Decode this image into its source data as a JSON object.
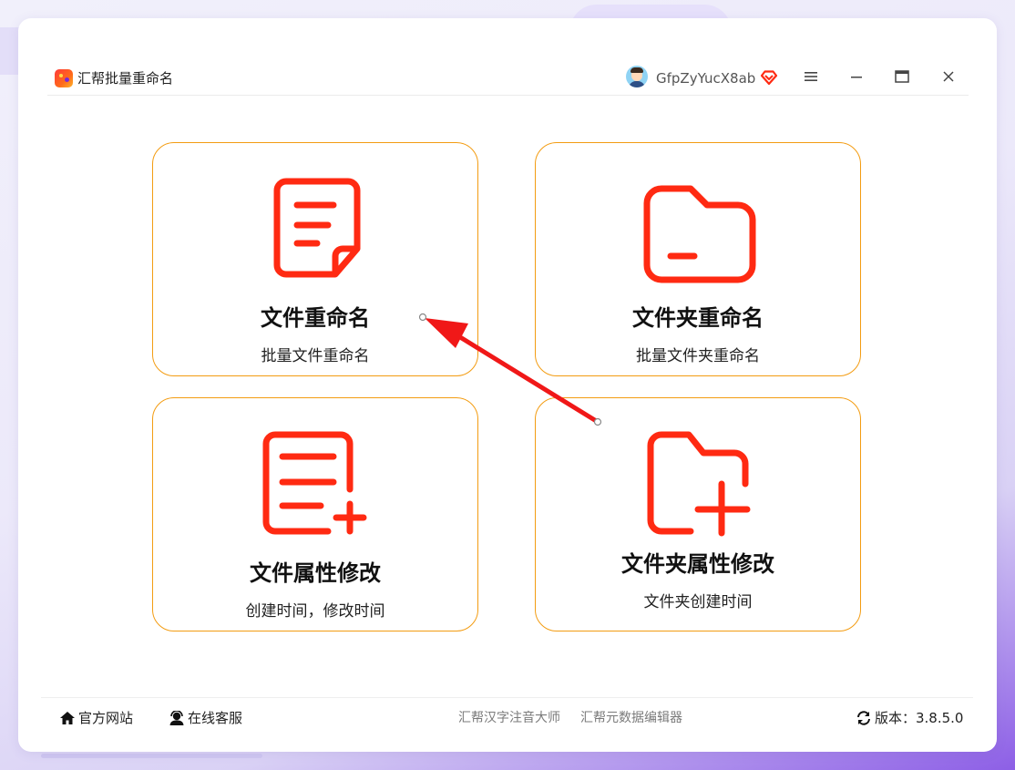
{
  "window": {
    "app_title": "汇帮批量重命名",
    "username": "GfpZyYucX8ab",
    "controls": {
      "menu_icon": "hamburger-icon",
      "minimize_icon": "minimize-icon",
      "maximize_icon": "maximize-icon",
      "close_icon": "close-icon"
    }
  },
  "cards": [
    {
      "title": "文件重命名",
      "subtitle": "批量文件重命名",
      "icon": "document-icon"
    },
    {
      "title": "文件夹重命名",
      "subtitle": "批量文件夹重命名",
      "icon": "folder-icon"
    },
    {
      "title": "文件属性修改",
      "subtitle": "创建时间，修改时间",
      "icon": "document-add-icon"
    },
    {
      "title": "文件夹属性修改",
      "subtitle": "文件夹创建时间",
      "icon": "folder-add-icon"
    }
  ],
  "footer": {
    "official_site": "官方网站",
    "support": "在线客服",
    "link_1": "汇帮汉字注音大师",
    "link_2": "汇帮元数据编辑器",
    "version": "版本：3.8.5.0"
  },
  "colors": {
    "accent_red": "#ff2a12",
    "card_border": "#f39c12",
    "arrow": "#f01818"
  }
}
